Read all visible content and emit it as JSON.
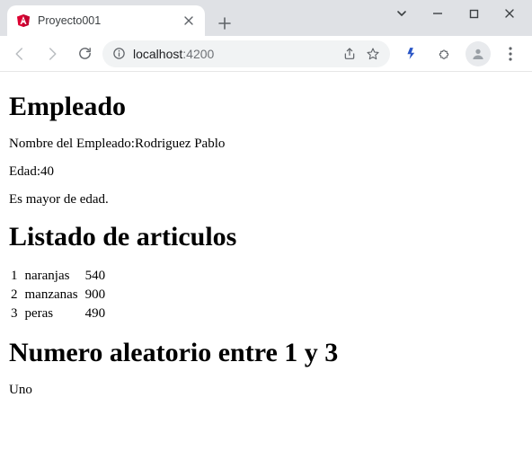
{
  "browser": {
    "tab_title": "Proyecto001",
    "url_host": "localhost",
    "url_port": ":4200"
  },
  "page": {
    "heading_empleado": "Empleado",
    "nombre_label": "Nombre del Empleado:",
    "nombre_valor": "Rodriguez Pablo",
    "edad_label": "Edad:",
    "edad_valor": "40",
    "edad_msg": "Es mayor de edad.",
    "heading_articulos": "Listado de articulos",
    "articulos": [
      {
        "n": "1",
        "nombre": "naranjas",
        "cant": "540"
      },
      {
        "n": "2",
        "nombre": "manzanas",
        "cant": "900"
      },
      {
        "n": "3",
        "nombre": "peras",
        "cant": "490"
      }
    ],
    "heading_random": "Numero aleatorio entre 1 y 3",
    "random_text": "Uno"
  }
}
